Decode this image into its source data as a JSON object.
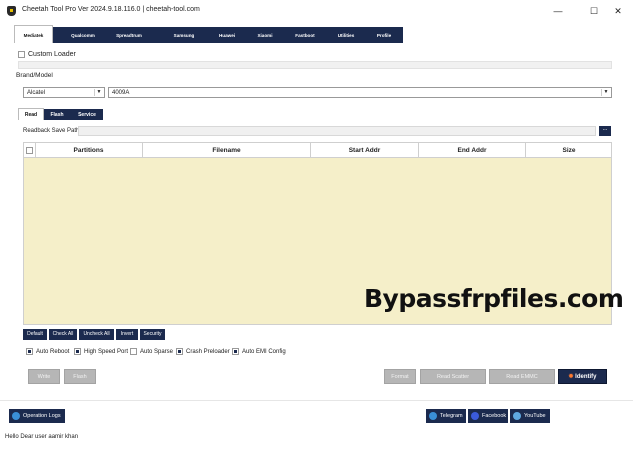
{
  "window": {
    "title": "Cheetah Tool Pro Ver 2024.9.18.116.0 | cheetah-tool.com",
    "controls": [
      "—",
      "☐",
      "✕"
    ]
  },
  "main_tabs": [
    "Mediatek",
    "Qualcomm",
    "Spreadtrum",
    "Samsung",
    "Huawei",
    "Xiaomi",
    "Fastboot",
    "Utilities",
    "Profile"
  ],
  "custom_loader": {
    "label": "Custom Loader",
    "checked": false
  },
  "brand_model": {
    "label": "Brand/Model",
    "brand": "Alcatel",
    "model": "4009A"
  },
  "sub_tabs": [
    "Read",
    "Flash",
    "Service"
  ],
  "readback": {
    "label": "Readback Save Path",
    "value": "",
    "browse_label": "..."
  },
  "table": {
    "headers": [
      "Partitions",
      "Filename",
      "Start Addr",
      "End Addr",
      "Size"
    ],
    "rows": []
  },
  "watermark": "Bypassfrpfiles.com",
  "table_buttons": [
    "Default",
    "Check All",
    "Uncheck All",
    "Invert",
    "Security"
  ],
  "options": [
    {
      "label": "Auto Reboot",
      "checked": true
    },
    {
      "label": "High Speed Port",
      "checked": true
    },
    {
      "label": "Auto Sparse",
      "checked": false
    },
    {
      "label": "Crash Preloader",
      "checked": true
    },
    {
      "label": "Auto EMI Config",
      "checked": true
    }
  ],
  "actions": {
    "write": "Write",
    "flash": "Flash",
    "format": "Format",
    "read_scatter": "Read Scatter",
    "read_emmc": "Read EMMC",
    "identify": "Identify"
  },
  "footer": {
    "operation_logs": "Operation Logs",
    "telegram": "Telegram",
    "facebook": "Facebook",
    "youtube": "YouTube"
  },
  "status_text": "Hello Dear user aamir khan",
  "colors": {
    "navy": "#1b2a4e",
    "table_bg": "#f5efc9",
    "disabled": "#b6b6b6"
  }
}
